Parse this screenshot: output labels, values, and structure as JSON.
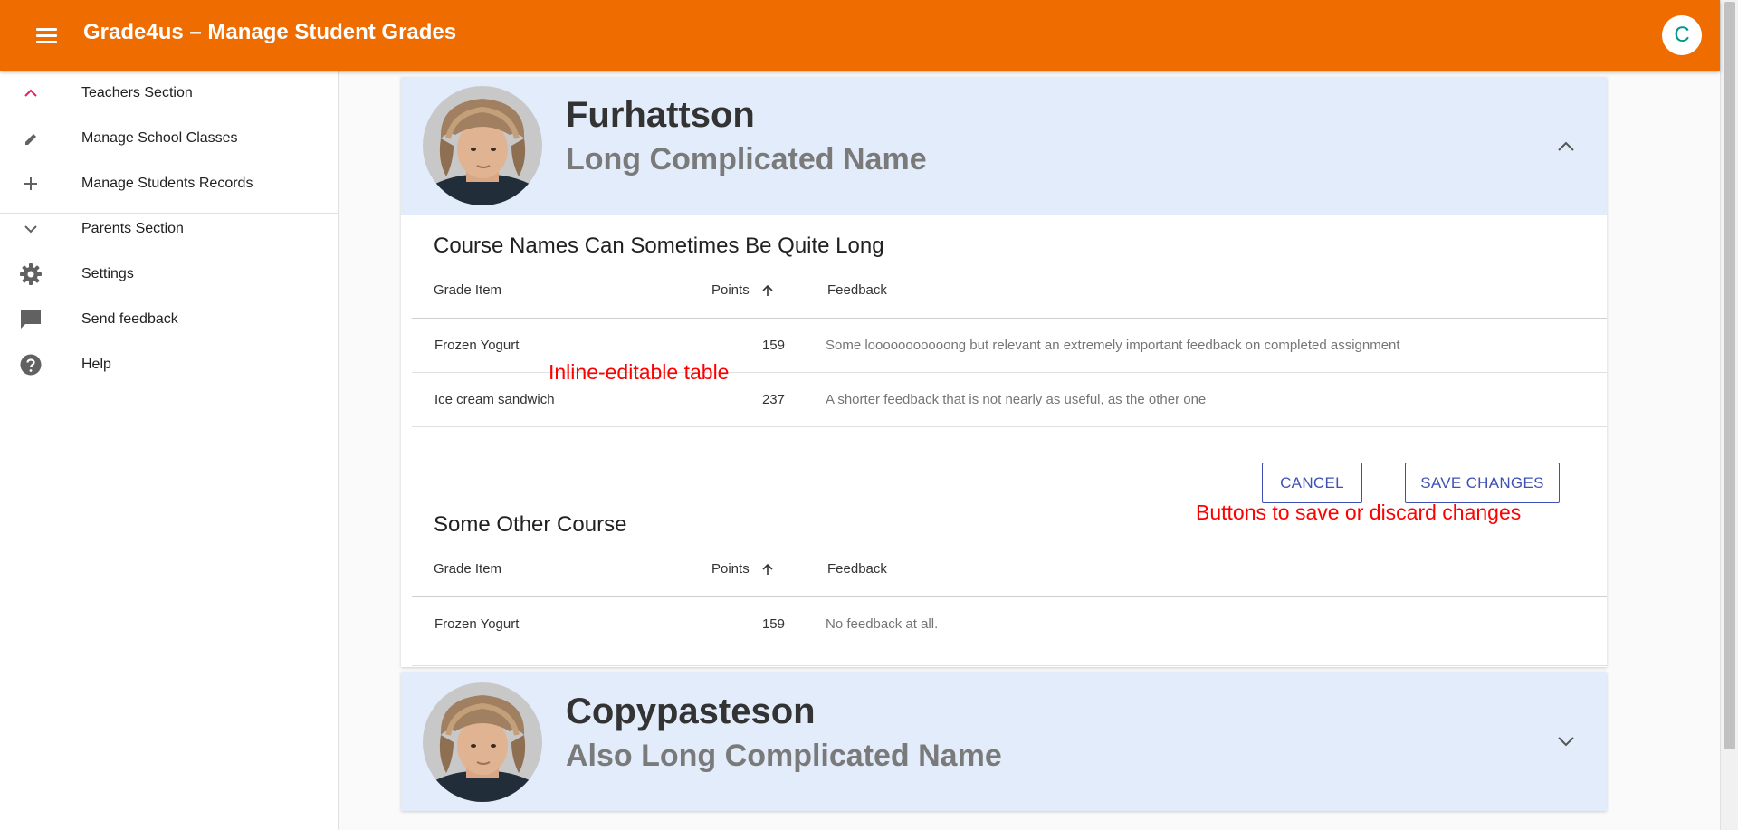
{
  "app": {
    "menu_icon": "menu-icon",
    "title": "Grade4us – Manage Student Grades",
    "user_initial": "C"
  },
  "colors": {
    "appbar": "#ef6c00",
    "card_header": "#e3ecfa",
    "accent": "#3f51b5",
    "annotation": "#ff0000",
    "avatar_text": "#009688"
  },
  "sidebar": {
    "items": [
      {
        "label": "Teachers Section",
        "icon": "chevron-up-icon"
      },
      {
        "label": "Manage School Classes",
        "icon": "pencil-icon"
      },
      {
        "label": "Manage Students Records",
        "icon": "plus-icon"
      },
      {
        "label": "Parents Section",
        "icon": "chevron-down-icon"
      },
      {
        "label": "Settings",
        "icon": "gear-icon"
      },
      {
        "label": "Send feedback",
        "icon": "feedback-icon"
      },
      {
        "label": "Help",
        "icon": "help-icon"
      }
    ]
  },
  "students": [
    {
      "name": "Furhattson",
      "subtitle": "Long Complicated Name",
      "expanded": true,
      "toggle_icon": "chevron-up-icon",
      "courses": [
        {
          "title": "Course Names Can Sometimes Be Quite Long",
          "columns": {
            "item": "Grade Item",
            "points": "Points",
            "feedback": "Feedback"
          },
          "sort_icon": "arrow-up-icon",
          "rows": [
            {
              "item": "Frozen Yogurt",
              "points": "159",
              "feedback": "Some looooooooooong but relevant an extremely important feedback on completed assignment"
            },
            {
              "item": "Ice cream sandwich",
              "points": "237",
              "feedback": "A shorter feedback that is not nearly as useful, as the other one"
            }
          ],
          "actions": {
            "cancel": "CANCEL",
            "save": "SAVE CHANGES"
          }
        },
        {
          "title": "Some Other Course",
          "columns": {
            "item": "Grade Item",
            "points": "Points",
            "feedback": "Feedback"
          },
          "sort_icon": "arrow-up-icon",
          "rows": [
            {
              "item": "Frozen Yogurt",
              "points": "159",
              "feedback": "No feedback at all."
            }
          ]
        }
      ]
    },
    {
      "name": "Copypasteson",
      "subtitle": "Also Long Complicated Name",
      "expanded": false,
      "toggle_icon": "chevron-down-icon"
    }
  ],
  "annotations": {
    "table": "Inline-editable table",
    "buttons": "Buttons to save or discard changes"
  }
}
